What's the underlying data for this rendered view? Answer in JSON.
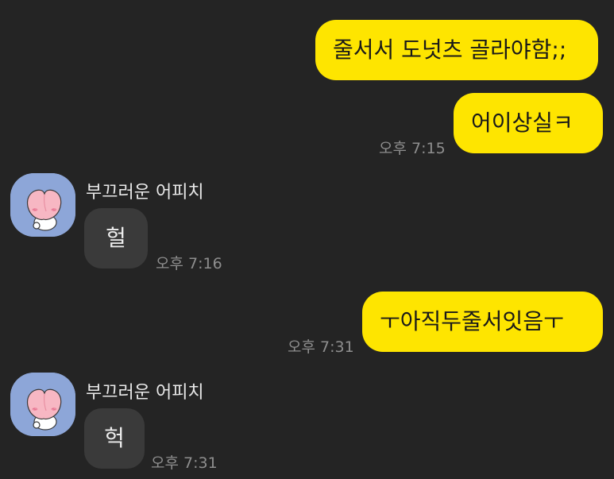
{
  "colors": {
    "background": "#242424",
    "my_bubble": "#FEE500",
    "other_bubble": "#3A3A3A",
    "time_text": "#8E8E8E",
    "avatar_bg": "#8DA6D8"
  },
  "messages": [
    {
      "from": "me",
      "text": "줄서서 도넛츠 골라야함;;",
      "time": ""
    },
    {
      "from": "me",
      "text": "어이상실ㅋ",
      "time": "오후 7:15"
    },
    {
      "from": "other",
      "sender": "부끄러운 어피치",
      "avatar_icon": "apeach-peach-icon",
      "text": "헐",
      "time": "오후 7:16"
    },
    {
      "from": "me",
      "text": "ㅜ아직두줄서잇음ㅜ",
      "time": "오후 7:31"
    },
    {
      "from": "other",
      "sender": "부끄러운 어피치",
      "avatar_icon": "apeach-peach-icon",
      "text": "헉",
      "time": "오후 7:31"
    }
  ]
}
